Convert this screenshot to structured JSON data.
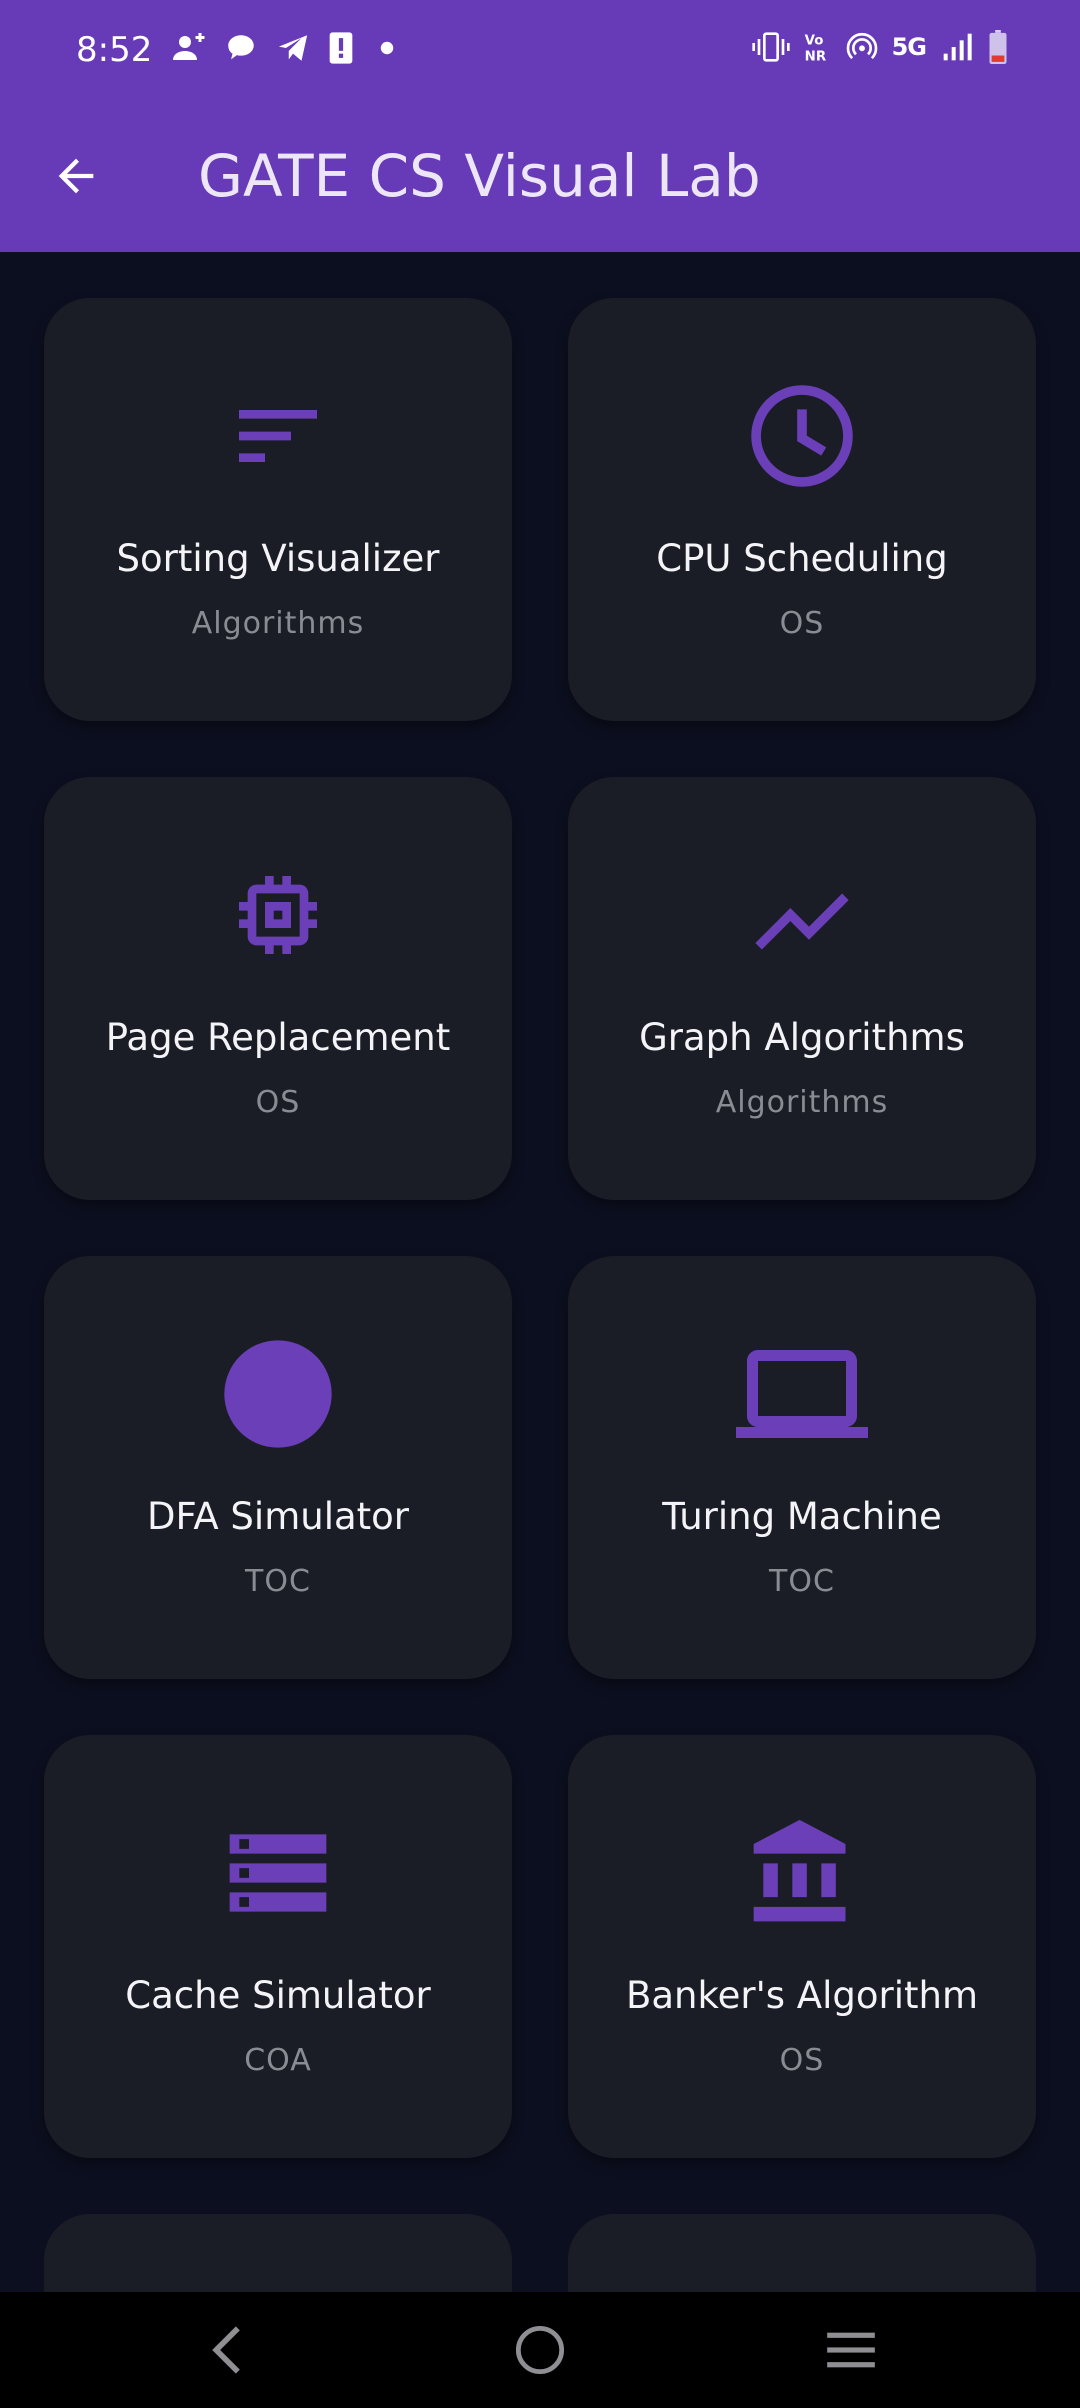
{
  "status_bar": {
    "time": "8:52",
    "network": "5G",
    "left_icons": [
      "person-add-icon",
      "chat-bubble-icon",
      "telegram-icon",
      "alert-icon",
      "dot-icon"
    ],
    "right_icons": [
      "vibrate-icon",
      "volte-icon",
      "hotspot-icon",
      "signal-icon",
      "battery-icon"
    ]
  },
  "app_bar": {
    "title": "GATE CS Visual Lab",
    "back_icon": "arrow-back-icon"
  },
  "colors": {
    "primary": "#673ab7",
    "background": "#0c0f1f",
    "card": "#1b1d26",
    "icon": "#6a3fb8",
    "title": "#f4f4f8",
    "subtitle": "#8a8c94"
  },
  "cards": [
    {
      "title": "Sorting Visualizer",
      "subtitle": "Algorithms",
      "icon": "sort-icon"
    },
    {
      "title": "CPU Scheduling",
      "subtitle": "OS",
      "icon": "clock-icon"
    },
    {
      "title": "Page Replacement",
      "subtitle": "OS",
      "icon": "memory-chip-icon"
    },
    {
      "title": "Graph Algorithms",
      "subtitle": "Algorithms",
      "icon": "trending-line-icon"
    },
    {
      "title": "DFA Simulator",
      "subtitle": "TOC",
      "icon": "circle-icon"
    },
    {
      "title": "Turing Machine",
      "subtitle": "TOC",
      "icon": "laptop-icon"
    },
    {
      "title": "Cache Simulator",
      "subtitle": "COA",
      "icon": "storage-icon"
    },
    {
      "title": "Banker's Algorithm",
      "subtitle": "OS",
      "icon": "bank-icon"
    }
  ],
  "nav_bar": {
    "back": "nav-back-icon",
    "home": "nav-home-icon",
    "recents": "nav-menu-icon"
  }
}
